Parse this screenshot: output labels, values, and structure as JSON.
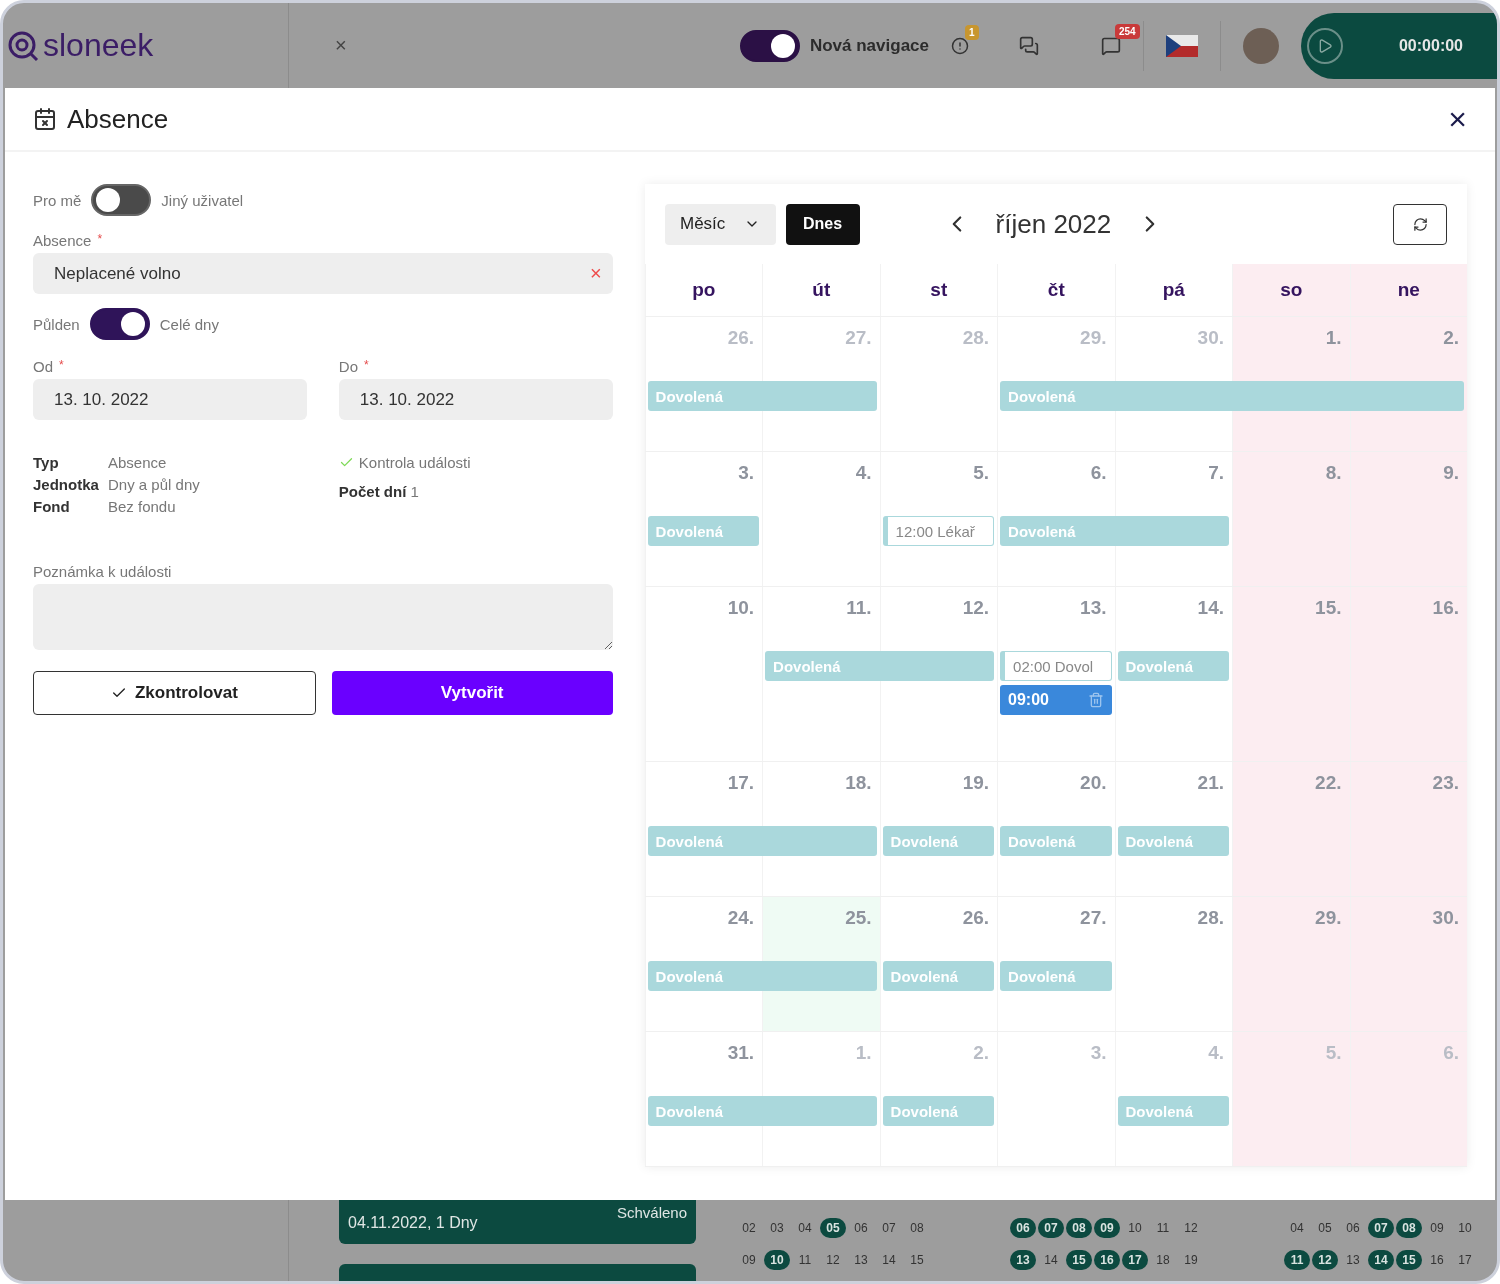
{
  "topbar": {
    "logo": "sloneek",
    "close": "×",
    "nav_toggle": {
      "label": "Nová navigace",
      "on": true
    },
    "alerts_badge": "1",
    "notifications_badge": "254",
    "timer": "00:00:00"
  },
  "dialog": {
    "title": "Absence",
    "close": "×"
  },
  "form": {
    "user_toggle": {
      "left": "Pro mě",
      "right": "Jiný uživatel",
      "on": false
    },
    "absence": {
      "label": "Absence",
      "mark": "*",
      "value": "Neplacené volno",
      "clear": "×"
    },
    "day_toggle": {
      "left": "Půlden",
      "right": "Celé dny",
      "on": true
    },
    "from": {
      "label": "Od",
      "mark": "*",
      "value": "13. 10. 2022"
    },
    "to": {
      "label": "Do",
      "mark": "*",
      "value": "13. 10. 2022"
    },
    "info": [
      {
        "key": "Typ",
        "value": "Absence"
      },
      {
        "key": "Jednotka",
        "value": "Dny a půl dny"
      },
      {
        "key": "Fond",
        "value": "Bez fondu"
      }
    ],
    "check": "Kontrola události",
    "days": {
      "label": "Počet dní",
      "value": "1"
    },
    "note": {
      "label": "Poznámka k události"
    },
    "buttons": [
      {
        "label": "Zkontrolovat",
        "kind": "secondary"
      },
      {
        "label": "Vytvořit",
        "kind": "primary"
      }
    ]
  },
  "calendar": {
    "view": "Měsíc",
    "today_button": "Dnes",
    "month": "říjen 2022",
    "weekdays": [
      {
        "label": "po",
        "weekend": false
      },
      {
        "label": "út",
        "weekend": false
      },
      {
        "label": "st",
        "weekend": false
      },
      {
        "label": "čt",
        "weekend": false
      },
      {
        "label": "pá",
        "weekend": false
      },
      {
        "label": "so",
        "weekend": true
      },
      {
        "label": "ne",
        "weekend": true
      }
    ],
    "weeks": [
      {
        "days": [
          {
            "label": "26.",
            "outside": true,
            "today": false,
            "events": [
              {
                "kind": "bar",
                "label": "Dovolená"
              }
            ]
          },
          {
            "label": "27.",
            "outside": true,
            "today": false,
            "events": [
              {
                "kind": "continued"
              }
            ]
          },
          {
            "label": "28.",
            "outside": true,
            "today": false
          },
          {
            "label": "29.",
            "outside": true,
            "today": false,
            "events": [
              {
                "kind": "bar",
                "label": "Dovolená"
              }
            ]
          },
          {
            "label": "30.",
            "outside": true,
            "today": false,
            "events": [
              {
                "kind": "continued"
              }
            ]
          },
          {
            "label": "1.",
            "outside": false,
            "today": false,
            "events": [
              {
                "kind": "continued"
              }
            ]
          },
          {
            "label": "2.",
            "outside": false,
            "today": false,
            "events": [
              {
                "kind": "continued"
              }
            ]
          }
        ]
      },
      {
        "days": [
          {
            "label": "3.",
            "outside": false,
            "today": false,
            "events": [
              {
                "kind": "bar",
                "label": "Dovolená"
              }
            ]
          },
          {
            "label": "4.",
            "outside": false,
            "today": false
          },
          {
            "label": "5.",
            "outside": false,
            "today": false,
            "events": [
              {
                "kind": "outline",
                "label": "12:00 Lékař"
              }
            ]
          },
          {
            "label": "6.",
            "outside": false,
            "today": false,
            "events": [
              {
                "kind": "bar",
                "label": "Dovolená"
              }
            ]
          },
          {
            "label": "7.",
            "outside": false,
            "today": false,
            "events": [
              {
                "kind": "continued"
              }
            ]
          },
          {
            "label": "8.",
            "outside": false,
            "today": false
          },
          {
            "label": "9.",
            "outside": false,
            "today": false
          }
        ]
      },
      {
        "days": [
          {
            "label": "10.",
            "outside": false,
            "today": false
          },
          {
            "label": "11.",
            "outside": false,
            "today": false,
            "events": [
              {
                "kind": "bar",
                "label": "Dovolená"
              }
            ]
          },
          {
            "label": "12.",
            "outside": false,
            "today": false,
            "events": [
              {
                "kind": "continued"
              }
            ]
          },
          {
            "label": "13.",
            "outside": false,
            "today": false,
            "events": [
              {
                "kind": "outline",
                "label": "02:00 Dovol"
              },
              {
                "kind": "selected",
                "label": "09:00"
              }
            ]
          },
          {
            "label": "14.",
            "outside": false,
            "today": false,
            "events": [
              {
                "kind": "bar",
                "label": "Dovolená"
              }
            ]
          },
          {
            "label": "15.",
            "outside": false,
            "today": false
          },
          {
            "label": "16.",
            "outside": false,
            "today": false
          }
        ]
      },
      {
        "days": [
          {
            "label": "17.",
            "outside": false,
            "today": false,
            "events": [
              {
                "kind": "bar",
                "label": "Dovolená"
              }
            ]
          },
          {
            "label": "18.",
            "outside": false,
            "today": false,
            "events": [
              {
                "kind": "continued"
              }
            ]
          },
          {
            "label": "19.",
            "outside": false,
            "today": false,
            "events": [
              {
                "kind": "bar",
                "label": "Dovolená"
              }
            ]
          },
          {
            "label": "20.",
            "outside": false,
            "today": false,
            "events": [
              {
                "kind": "bar",
                "label": "Dovolená"
              }
            ]
          },
          {
            "label": "21.",
            "outside": false,
            "today": false,
            "events": [
              {
                "kind": "bar",
                "label": "Dovolená"
              }
            ]
          },
          {
            "label": "22.",
            "outside": false,
            "today": false
          },
          {
            "label": "23.",
            "outside": false,
            "today": false
          }
        ]
      },
      {
        "days": [
          {
            "label": "24.",
            "outside": false,
            "today": false,
            "events": [
              {
                "kind": "bar",
                "label": "Dovolená"
              }
            ]
          },
          {
            "label": "25.",
            "outside": false,
            "today": true,
            "events": [
              {
                "kind": "continued"
              }
            ]
          },
          {
            "label": "26.",
            "outside": false,
            "today": false,
            "events": [
              {
                "kind": "bar",
                "label": "Dovolená"
              }
            ]
          },
          {
            "label": "27.",
            "outside": false,
            "today": false,
            "events": [
              {
                "kind": "bar",
                "label": "Dovolená"
              }
            ]
          },
          {
            "label": "28.",
            "outside": false,
            "today": false
          },
          {
            "label": "29.",
            "outside": false,
            "today": false
          },
          {
            "label": "30.",
            "outside": false,
            "today": false
          }
        ]
      },
      {
        "days": [
          {
            "label": "31.",
            "outside": false,
            "today": false,
            "events": [
              {
                "kind": "bar",
                "label": "Dovolená"
              }
            ]
          },
          {
            "label": "1.",
            "outside": true,
            "today": false,
            "events": [
              {
                "kind": "continued"
              }
            ]
          },
          {
            "label": "2.",
            "outside": true,
            "today": false,
            "events": [
              {
                "kind": "bar",
                "label": "Dovolená"
              }
            ]
          },
          {
            "label": "3.",
            "outside": true,
            "today": false
          },
          {
            "label": "4.",
            "outside": true,
            "today": false,
            "events": [
              {
                "kind": "bar",
                "label": "Dovolená"
              }
            ]
          },
          {
            "label": "5.",
            "outside": true,
            "today": false
          },
          {
            "label": "6.",
            "outside": true,
            "today": false
          }
        ]
      }
    ]
  },
  "background": {
    "card": {
      "date": "04.11.2022, 1 Dny",
      "status": "Schváleno"
    },
    "mini_calendars": [
      {
        "rows": [
          [
            {
              "label": "02",
              "highlighted": false
            },
            {
              "label": "03",
              "highlighted": false
            },
            {
              "label": "04",
              "highlighted": false
            },
            {
              "label": "05",
              "highlighted": true
            },
            {
              "label": "06",
              "highlighted": false
            },
            {
              "label": "07",
              "highlighted": false
            },
            {
              "label": "08",
              "highlighted": false
            }
          ],
          [
            {
              "label": "09",
              "highlighted": false
            },
            {
              "label": "10",
              "highlighted": true
            },
            {
              "label": "11",
              "highlighted": false
            },
            {
              "label": "12",
              "highlighted": false
            },
            {
              "label": "13",
              "highlighted": false
            },
            {
              "label": "14",
              "highlighted": false
            },
            {
              "label": "15",
              "highlighted": false
            }
          ]
        ]
      },
      {
        "rows": [
          [
            {
              "label": "06",
              "highlighted": true
            },
            {
              "label": "07",
              "highlighted": true
            },
            {
              "label": "08",
              "highlighted": true
            },
            {
              "label": "09",
              "highlighted": true
            },
            {
              "label": "10",
              "highlighted": false
            },
            {
              "label": "11",
              "highlighted": false
            },
            {
              "label": "12",
              "highlighted": false
            }
          ],
          [
            {
              "label": "13",
              "highlighted": true
            },
            {
              "label": "14",
              "highlighted": false
            },
            {
              "label": "15",
              "highlighted": true
            },
            {
              "label": "16",
              "highlighted": true
            },
            {
              "label": "17",
              "highlighted": true
            },
            {
              "label": "18",
              "highlighted": false
            },
            {
              "label": "19",
              "highlighted": false
            }
          ]
        ]
      },
      {
        "rows": [
          [
            {
              "label": "04",
              "highlighted": false
            },
            {
              "label": "05",
              "highlighted": false
            },
            {
              "label": "06",
              "highlighted": false
            },
            {
              "label": "07",
              "highlighted": true
            },
            {
              "label": "08",
              "highlighted": true
            },
            {
              "label": "09",
              "highlighted": false
            },
            {
              "label": "10",
              "highlighted": false
            }
          ],
          [
            {
              "label": "11",
              "highlighted": true
            },
            {
              "label": "12",
              "highlighted": true
            },
            {
              "label": "13",
              "highlighted": false
            },
            {
              "label": "14",
              "highlighted": true
            },
            {
              "label": "15",
              "highlighted": true
            },
            {
              "label": "16",
              "highlighted": false
            },
            {
              "label": "17",
              "highlighted": false
            }
          ]
        ]
      }
    ]
  }
}
